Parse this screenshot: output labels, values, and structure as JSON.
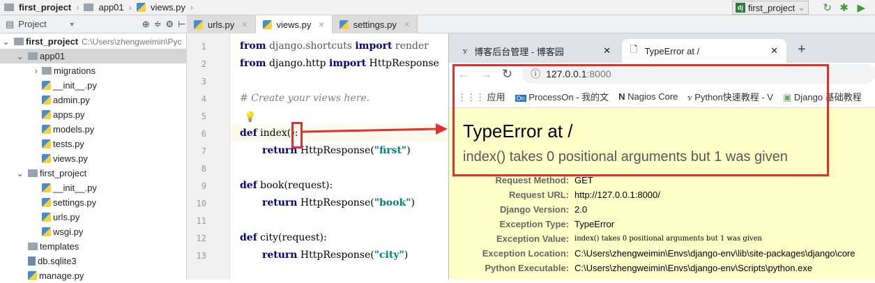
{
  "breadcrumb": [
    "first_project",
    "app01",
    "views.py"
  ],
  "run_config": "first_project",
  "tool_window": {
    "title": "Project"
  },
  "editor_tabs": [
    {
      "label": "urls.py"
    },
    {
      "label": "views.py",
      "active": true
    },
    {
      "label": "settings.py"
    }
  ],
  "tree": [
    {
      "label": "first_project",
      "extra": "C:\\Users\\zhengweimin\\Pyc",
      "depth": 0,
      "type": "folder",
      "expanded": true,
      "bold": true
    },
    {
      "label": "app01",
      "depth": 1,
      "type": "folder",
      "expanded": true,
      "selected": true
    },
    {
      "label": "migrations",
      "depth": 2,
      "type": "folder",
      "expanded": false
    },
    {
      "label": "__init__.py",
      "depth": 2,
      "type": "py"
    },
    {
      "label": "admin.py",
      "depth": 2,
      "type": "py"
    },
    {
      "label": "apps.py",
      "depth": 2,
      "type": "py"
    },
    {
      "label": "models.py",
      "depth": 2,
      "type": "py"
    },
    {
      "label": "tests.py",
      "depth": 2,
      "type": "py"
    },
    {
      "label": "views.py",
      "depth": 2,
      "type": "py"
    },
    {
      "label": "first_project",
      "depth": 1,
      "type": "folder",
      "expanded": true
    },
    {
      "label": "__init__.py",
      "depth": 2,
      "type": "py"
    },
    {
      "label": "settings.py",
      "depth": 2,
      "type": "py"
    },
    {
      "label": "urls.py",
      "depth": 2,
      "type": "py"
    },
    {
      "label": "wsgi.py",
      "depth": 2,
      "type": "py"
    },
    {
      "label": "templates",
      "depth": 1,
      "type": "folder"
    },
    {
      "label": "db.sqlite3",
      "depth": 1,
      "type": "db"
    },
    {
      "label": "manage.py",
      "depth": 1,
      "type": "py"
    }
  ],
  "code": {
    "line_numbers": [
      "1",
      "2",
      "3",
      "4",
      "5",
      "6",
      "7",
      "8",
      "9",
      "10",
      "11",
      "12",
      "13"
    ],
    "l1": {
      "a": "from",
      "b": " django.shortcuts ",
      "c": "import",
      "d": " render"
    },
    "l2": {
      "a": "from",
      "b": " django.http ",
      "c": "import",
      "d": " HttpResponse"
    },
    "l4": "# Create your views here.",
    "l6": {
      "a": "def",
      "b": " index():"
    },
    "l7": {
      "a": "return",
      "b": " HttpResponse(",
      "c": "\"first\"",
      "d": ")"
    },
    "l9": {
      "a": "def",
      "b": " book(request):"
    },
    "l10": {
      "a": "return",
      "b": " HttpResponse(",
      "c": "\"book\"",
      "d": ")"
    },
    "l12": {
      "a": "def",
      "b": " city(request):"
    },
    "l13": {
      "a": "return",
      "b": " HttpResponse(",
      "c": "\"city\"",
      "d": ")"
    }
  },
  "browser": {
    "tabs": [
      {
        "title": "博客后台管理 - 博客园"
      },
      {
        "title": "TypeError at /",
        "active": true
      }
    ],
    "url_host": "127.0.0.1",
    "url_port": ":8000",
    "bookmarks": [
      "应用",
      "ProcessOn - 我的文",
      "Nagios Core",
      "Python快速教程 - V",
      "Django 基础教程"
    ],
    "error_title": "TypeError at /",
    "error_message": "index() takes 0 positional arguments but 1 was given",
    "meta": [
      {
        "k": "Request Method:",
        "v": "GET"
      },
      {
        "k": "Request URL:",
        "v": "http://127.0.0.1:8000/"
      },
      {
        "k": "Django Version:",
        "v": "2.0"
      },
      {
        "k": "Exception Type:",
        "v": "TypeError"
      },
      {
        "k": "Exception Value:",
        "v": "index() takes 0 positional arguments but 1 was given",
        "mono": true
      },
      {
        "k": "Exception Location:",
        "v": "C:\\Users\\zhengweimin\\Envs\\django-env\\lib\\site-packages\\django\\core"
      },
      {
        "k": "Python Executable:",
        "v": "C:\\Users\\zhengweimin\\Envs\\django-env\\Scripts\\python.exe"
      }
    ]
  },
  "colors": {
    "highlight": "#e03030",
    "page_bg": "#ffffc8"
  }
}
